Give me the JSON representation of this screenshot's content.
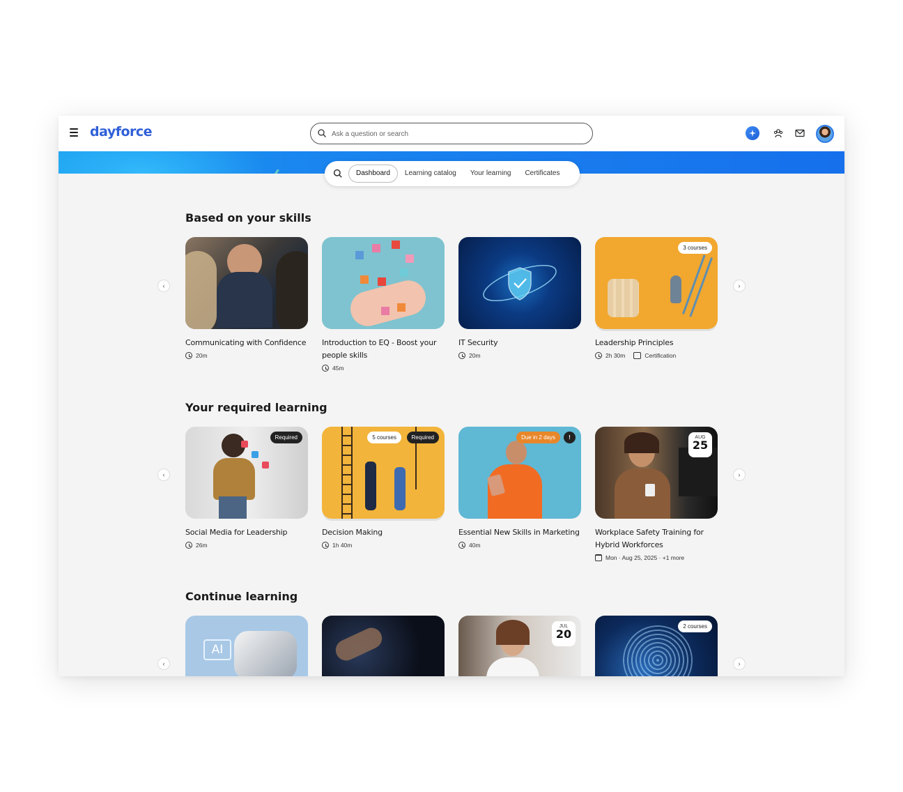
{
  "header": {
    "logo": "dayforce",
    "search_placeholder": "Ask a question or search"
  },
  "tabs": [
    {
      "label": "Dashboard",
      "active": true
    },
    {
      "label": "Learning catalog",
      "active": false
    },
    {
      "label": "Your learning",
      "active": false
    },
    {
      "label": "Certificates",
      "active": false
    }
  ],
  "sections": {
    "skills": {
      "title": "Based on your skills",
      "cards": [
        {
          "title": "Communicating with Confidence",
          "duration": "20m"
        },
        {
          "title": "Introduction to EQ - Boost your people skills",
          "duration": "45m"
        },
        {
          "title": "IT Security",
          "duration": "20m"
        },
        {
          "title": "Leadership Principles",
          "duration": "2h 30m",
          "badge": "3 courses",
          "extra": "Certification"
        }
      ]
    },
    "required": {
      "title": "Your required learning",
      "cards": [
        {
          "title": "Social Media for Leadership",
          "duration": "26m",
          "badge": "Required"
        },
        {
          "title": "Decision Making",
          "duration": "1h 40m",
          "badge_courses": "5 courses",
          "badge": "Required"
        },
        {
          "title": "Essential New Skills in Marketing",
          "duration": "40m",
          "badge": "Due in 2 days",
          "alert": "!"
        },
        {
          "title": "Workplace Safety Training for Hybrid Workforces",
          "date_month": "AUG",
          "date_day": "25",
          "schedule": "Mon · Aug 25, 2025 · +1 more"
        }
      ]
    },
    "continue": {
      "title": "Continue learning",
      "cards": [
        {
          "label": "AI"
        },
        {},
        {
          "date_month": "JUL",
          "date_day": "20"
        },
        {
          "badge": "2 courses"
        }
      ]
    }
  },
  "arrows": {
    "prev": "‹",
    "next": "›"
  },
  "colors": {
    "brand": "#2f5fd8",
    "banner": "#1670ec",
    "due": "#e8872a"
  }
}
